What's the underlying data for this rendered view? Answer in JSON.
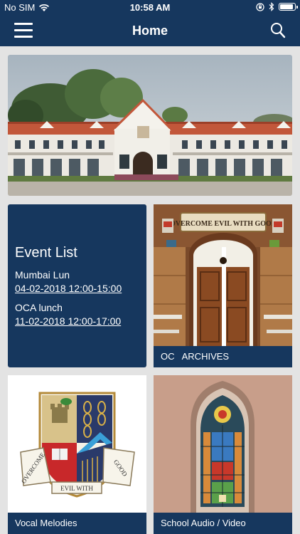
{
  "status_bar": {
    "carrier": "No SIM",
    "time": "10:58 AM",
    "battery_level": 0.9,
    "icons": [
      "wifi-icon",
      "orientation-lock-icon",
      "bluetooth-icon",
      "battery-icon"
    ]
  },
  "navbar": {
    "title": "Home",
    "left_icon": "hamburger-menu-icon",
    "right_icon": "search-icon"
  },
  "colors": {
    "primary": "#16375e",
    "background": "#e3e3e3",
    "text_on_primary": "#ffffff"
  },
  "event_list": {
    "title": "Event List",
    "events": [
      {
        "name": "Mumbai Lun",
        "time": "04-02-2018 12:00-15:00"
      },
      {
        "name": "OCA lunch",
        "time": "11-02-2018 12:00-17:00"
      }
    ]
  },
  "tiles": {
    "archives": {
      "label": "OC   ARCHIVES",
      "sign_text": "OVERCOME EVIL WITH GOOD"
    },
    "vocal": {
      "label": "Vocal Melodies",
      "crest_motto": [
        "OVERCOME",
        "EVIL WITH",
        "GOOD"
      ]
    },
    "audio": {
      "label": "School Audio / Video"
    }
  }
}
